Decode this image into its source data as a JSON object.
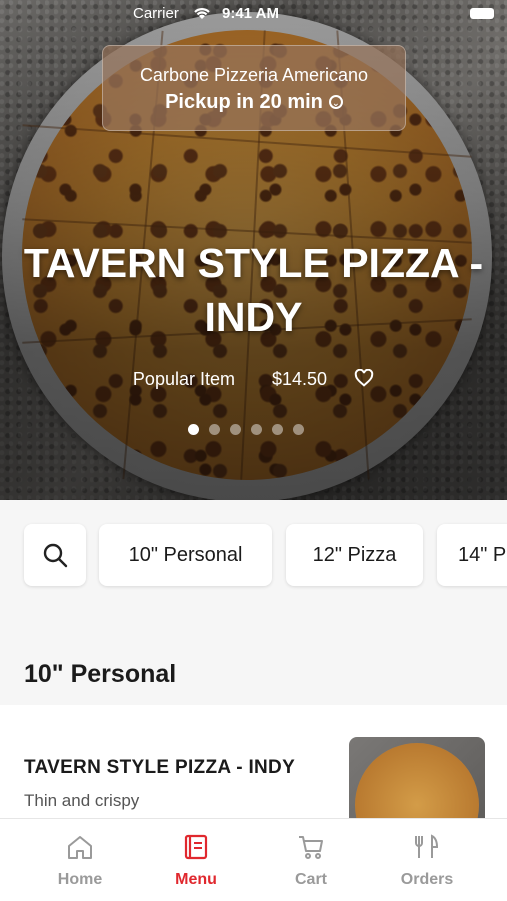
{
  "status_bar": {
    "carrier": "Carrier",
    "time": "9:41 AM"
  },
  "store": {
    "name": "Carbone Pizzeria Americano",
    "pickup": "Pickup in 20 min"
  },
  "hero": {
    "title": "TAVERN STYLE PIZZA - INDY",
    "tag": "Popular Item",
    "price": "$14.50",
    "carousel_total": 6,
    "carousel_active": 1
  },
  "categories": [
    "10\" Personal",
    "12\" Pizza",
    "14\" P"
  ],
  "section": {
    "title": "10\" Personal"
  },
  "item": {
    "name": "TAVERN STYLE PIZZA - INDY",
    "description": "Thin and crispy"
  },
  "tabs": [
    {
      "label": "Home",
      "icon": "home-icon",
      "active": false
    },
    {
      "label": "Menu",
      "icon": "menu-icon",
      "active": true
    },
    {
      "label": "Cart",
      "icon": "cart-icon",
      "active": false
    },
    {
      "label": "Orders",
      "icon": "orders-icon",
      "active": false
    }
  ],
  "colors": {
    "accent": "#e0282e",
    "inactive_tab": "#9a9a9a"
  }
}
